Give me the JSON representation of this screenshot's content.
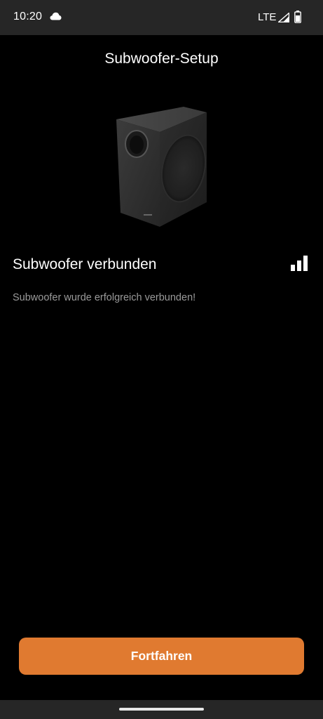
{
  "status_bar": {
    "time": "10:20",
    "network": "LTE",
    "icons": [
      "cloud-icon",
      "cell-signal-icon",
      "battery-icon"
    ]
  },
  "page": {
    "title": "Subwoofer-Setup"
  },
  "product": {
    "image_icon": "subwoofer-image"
  },
  "connection": {
    "title": "Subwoofer verbunden",
    "message": "Subwoofer wurde erfolgreich verbunden!",
    "signal_icon": "signal-strength-icon"
  },
  "actions": {
    "continue_label": "Fortfahren"
  },
  "colors": {
    "accent": "#e07a30",
    "background": "#000000",
    "bar_background": "#262626",
    "secondary_text": "#9a9a9a"
  }
}
